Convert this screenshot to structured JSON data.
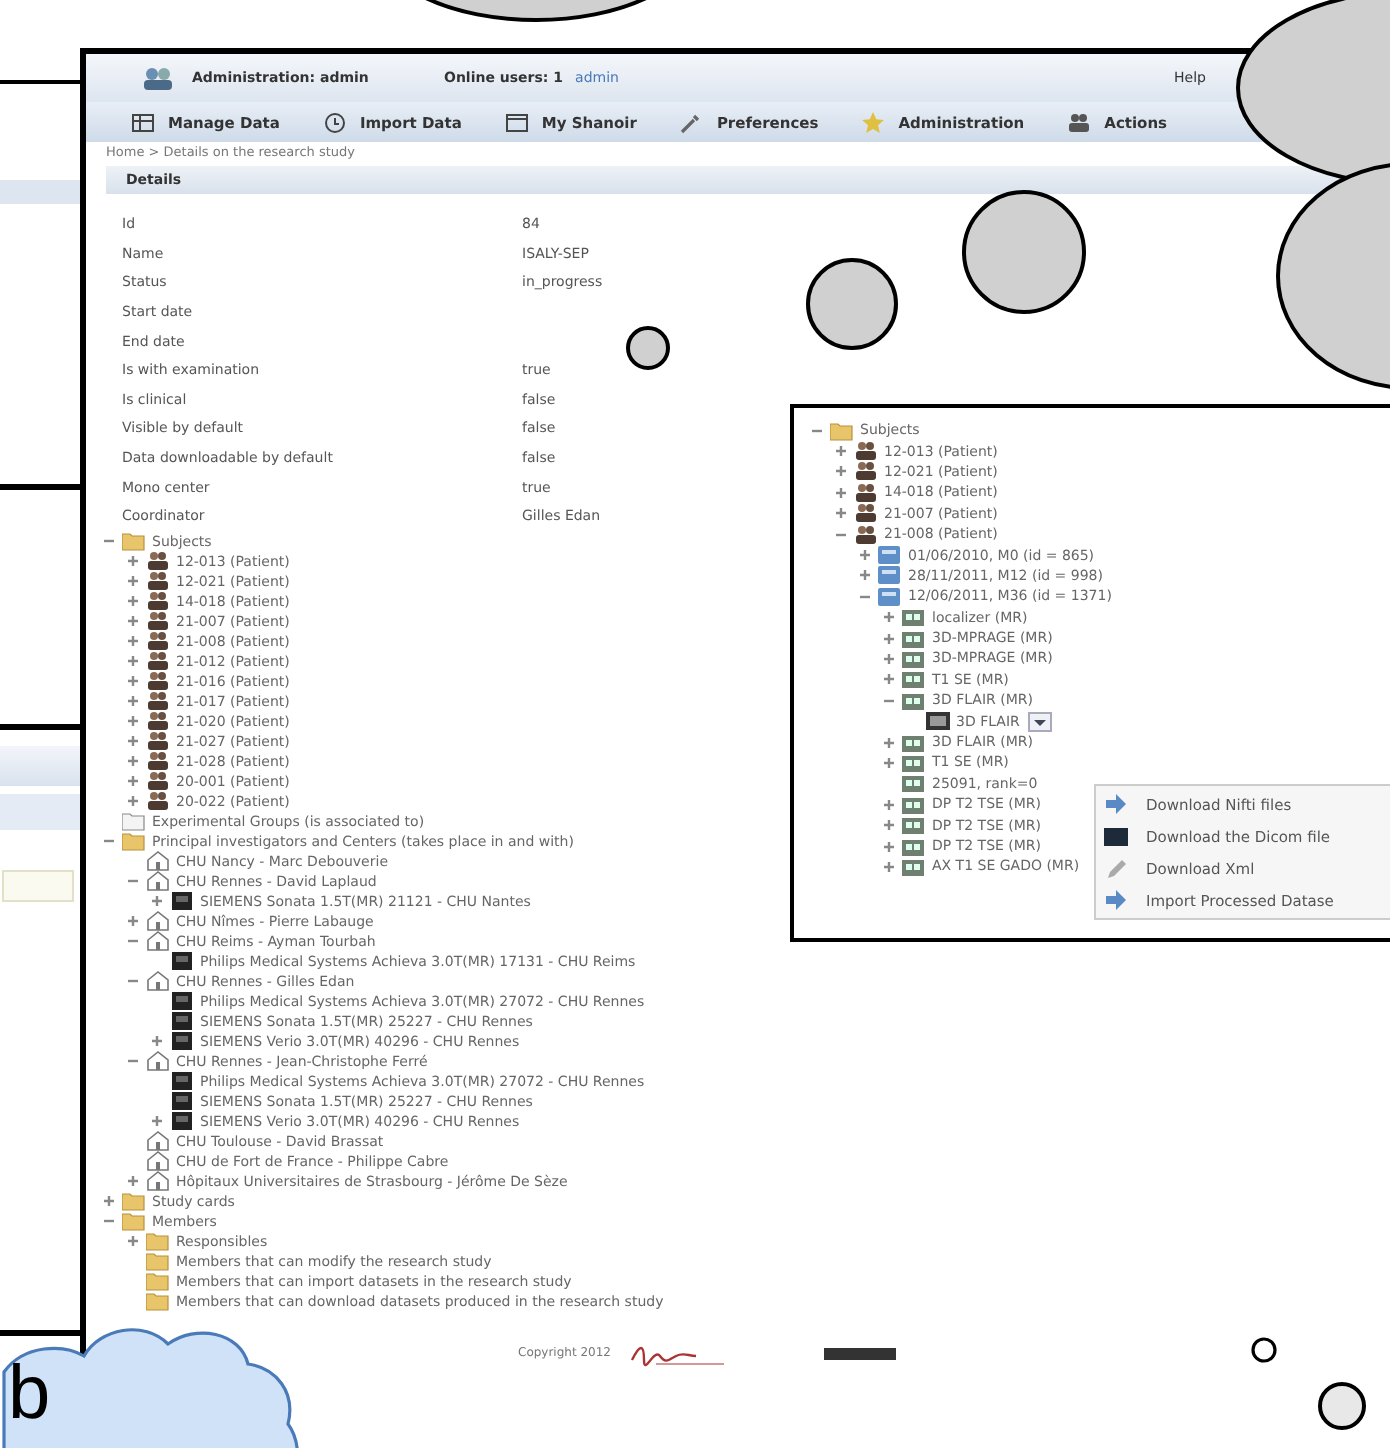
{
  "header": {
    "user": "Administration: admin",
    "online": "Online users: 1",
    "online_link": "admin",
    "help": "Help"
  },
  "menu": [
    {
      "label": "Manage Data",
      "kind": "data"
    },
    {
      "label": "Import Data",
      "kind": "import"
    },
    {
      "label": "My Shanoir",
      "kind": "window"
    },
    {
      "label": "Preferences",
      "kind": "tools"
    },
    {
      "label": "Administration",
      "kind": "star"
    },
    {
      "label": "Actions",
      "kind": "people"
    }
  ],
  "breadcrumb": "Home > Details on the research study",
  "details": {
    "title": "Details",
    "rows": [
      {
        "label": "Id",
        "value": "84"
      },
      {
        "label": "Name",
        "value": "ISALY-SEP"
      },
      {
        "label": "Status",
        "value": "in_progress"
      },
      {
        "label": "Start date"
      },
      {
        "label": "End date"
      },
      {
        "label": "Is with examination",
        "value": "true"
      },
      {
        "label": "Is clinical",
        "value": "false"
      },
      {
        "label": "Visible by default",
        "value": "false"
      },
      {
        "label": "Data downloadable by default",
        "value": "false"
      },
      {
        "label": "Mono center",
        "value": "true"
      },
      {
        "label": "Coordinator",
        "value": "Gilles Edan"
      }
    ]
  },
  "tree": [
    {
      "label": "Subjects",
      "kind": "folder",
      "expanded": true,
      "children": [
        {
          "label": "12-013 (Patient)",
          "kind": "patient",
          "expanded": false
        },
        {
          "label": "12-021 (Patient)",
          "kind": "patient",
          "expanded": false
        },
        {
          "label": "14-018 (Patient)",
          "kind": "patient",
          "expanded": false
        },
        {
          "label": "21-007 (Patient)",
          "kind": "patient",
          "expanded": false
        },
        {
          "label": "21-008 (Patient)",
          "kind": "patient",
          "expanded": false
        },
        {
          "label": "21-012 (Patient)",
          "kind": "patient",
          "expanded": false
        },
        {
          "label": "21-016 (Patient)",
          "kind": "patient",
          "expanded": false
        },
        {
          "label": "21-017 (Patient)",
          "kind": "patient",
          "expanded": false
        },
        {
          "label": "21-020 (Patient)",
          "kind": "patient",
          "expanded": false
        },
        {
          "label": "21-027 (Patient)",
          "kind": "patient",
          "expanded": false
        },
        {
          "label": "21-028 (Patient)",
          "kind": "patient",
          "expanded": false
        },
        {
          "label": "20-001 (Patient)",
          "kind": "patient",
          "expanded": false
        },
        {
          "label": "20-022 (Patient)",
          "kind": "patient",
          "expanded": false
        }
      ]
    },
    {
      "label": "Experimental Groups (is associated to)",
      "kind": "group"
    },
    {
      "label": "Principal investigators and Centers (takes place in and with)",
      "kind": "folder",
      "expanded": true,
      "children": [
        {
          "label": "CHU Nancy - Marc Debouverie",
          "kind": "center"
        },
        {
          "label": "CHU Rennes - David Laplaud",
          "kind": "center",
          "expanded": true,
          "children": [
            {
              "label": "SIEMENS Sonata 1.5T(MR) 21121 - CHU Nantes",
              "kind": "scanner",
              "expanded": false
            }
          ]
        },
        {
          "label": "CHU Nîmes - Pierre Labauge",
          "kind": "center",
          "expanded": false
        },
        {
          "label": "CHU Reims - Ayman Tourbah",
          "kind": "center",
          "expanded": true,
          "children": [
            {
              "label": "Philips Medical Systems Achieva 3.0T(MR) 17131 - CHU Reims",
              "kind": "scanner"
            }
          ]
        },
        {
          "label": "CHU Rennes - Gilles Edan",
          "kind": "center",
          "expanded": true,
          "children": [
            {
              "label": "Philips Medical Systems Achieva 3.0T(MR) 27072 - CHU Rennes",
              "kind": "scanner"
            },
            {
              "label": "SIEMENS Sonata 1.5T(MR) 25227 - CHU Rennes",
              "kind": "scanner"
            },
            {
              "label": "SIEMENS Verio 3.0T(MR) 40296 - CHU Rennes",
              "kind": "scanner",
              "expanded": false
            }
          ]
        },
        {
          "label": "CHU Rennes - Jean-Christophe Ferré",
          "kind": "center",
          "expanded": true,
          "children": [
            {
              "label": "Philips Medical Systems Achieva 3.0T(MR) 27072 - CHU Rennes",
              "kind": "scanner"
            },
            {
              "label": "SIEMENS Sonata 1.5T(MR) 25227 - CHU Rennes",
              "kind": "scanner"
            },
            {
              "label": "SIEMENS Verio 3.0T(MR) 40296 - CHU Rennes",
              "kind": "scanner",
              "expanded": false
            }
          ]
        },
        {
          "label": "CHU Toulouse - David Brassat",
          "kind": "center"
        },
        {
          "label": "CHU de Fort de France - Philippe Cabre",
          "kind": "center"
        },
        {
          "label": "Hôpitaux Universitaires de Strasbourg - Jérôme De Sèze",
          "kind": "center",
          "expanded": false
        }
      ]
    },
    {
      "label": "Study cards",
      "kind": "folder",
      "expanded": false
    },
    {
      "label": "Members",
      "kind": "folder",
      "expanded": true,
      "children": [
        {
          "label": "Responsibles",
          "kind": "folder",
          "expanded": false
        },
        {
          "label": "Members that can modify the research study",
          "kind": "folder"
        },
        {
          "label": "Members that can import datasets in the research study",
          "kind": "folder"
        },
        {
          "label": "Members that can download datasets produced in the research study",
          "kind": "folder"
        }
      ]
    }
  ],
  "footer": {
    "copyright": "Copyright 2012"
  },
  "inset": {
    "tree": [
      {
        "label": "Subjects",
        "kind": "folder",
        "expanded": true,
        "children": [
          {
            "label": "12-013 (Patient)",
            "kind": "patient",
            "expanded": false
          },
          {
            "label": "12-021 (Patient)",
            "kind": "patient",
            "expanded": false
          },
          {
            "label": "14-018 (Patient)",
            "kind": "patient",
            "expanded": false
          },
          {
            "label": "21-007 (Patient)",
            "kind": "patient",
            "expanded": false
          },
          {
            "label": "21-008 (Patient)",
            "kind": "patient",
            "expanded": true,
            "children": [
              {
                "label": "01/06/2010, M0 (id = 865)",
                "kind": "exam",
                "expanded": false
              },
              {
                "label": "28/11/2011, M12 (id = 998)",
                "kind": "exam",
                "expanded": false
              },
              {
                "label": "12/06/2011, M36 (id = 1371)",
                "kind": "exam",
                "expanded": true,
                "children": [
                  {
                    "label": "localizer (MR)",
                    "kind": "serie",
                    "expanded": false
                  },
                  {
                    "label": "3D-MPRAGE (MR)",
                    "kind": "serie",
                    "expanded": false
                  },
                  {
                    "label": "3D-MPRAGE (MR)",
                    "kind": "serie",
                    "expanded": false
                  },
                  {
                    "label": "T1 SE (MR)",
                    "kind": "serie",
                    "expanded": false
                  },
                  {
                    "label": "3D FLAIR (MR)",
                    "kind": "serie",
                    "expanded": true,
                    "children": [
                      {
                        "label": "3D FLAIR",
                        "kind": "dataset",
                        "menu": true
                      }
                    ]
                  },
                  {
                    "label": "3D FLAIR (MR)",
                    "kind": "serie",
                    "expanded": false
                  },
                  {
                    "label": "T1 SE (MR)",
                    "kind": "serie",
                    "expanded": false
                  },
                  {
                    "label": "25091, rank=0",
                    "kind": "serie"
                  },
                  {
                    "label": "DP T2 TSE (MR)",
                    "kind": "serie",
                    "expanded": false
                  },
                  {
                    "label": "DP T2 TSE (MR)",
                    "kind": "serie",
                    "expanded": false
                  },
                  {
                    "label": "DP T2 TSE (MR)",
                    "kind": "serie",
                    "expanded": false
                  },
                  {
                    "label": "AX T1 SE GADO (MR)",
                    "kind": "serie",
                    "expanded": false
                  }
                ]
              }
            ]
          }
        ]
      }
    ],
    "context_menu": [
      {
        "label": "Download Nifti files",
        "kind": "arrow"
      },
      {
        "label": "Download the Dicom file",
        "kind": "dicom"
      },
      {
        "label": "Download Xml",
        "kind": "xml"
      },
      {
        "label": "Import Processed Datase",
        "kind": "arrow"
      }
    ]
  },
  "callout": {
    "label": "b"
  }
}
